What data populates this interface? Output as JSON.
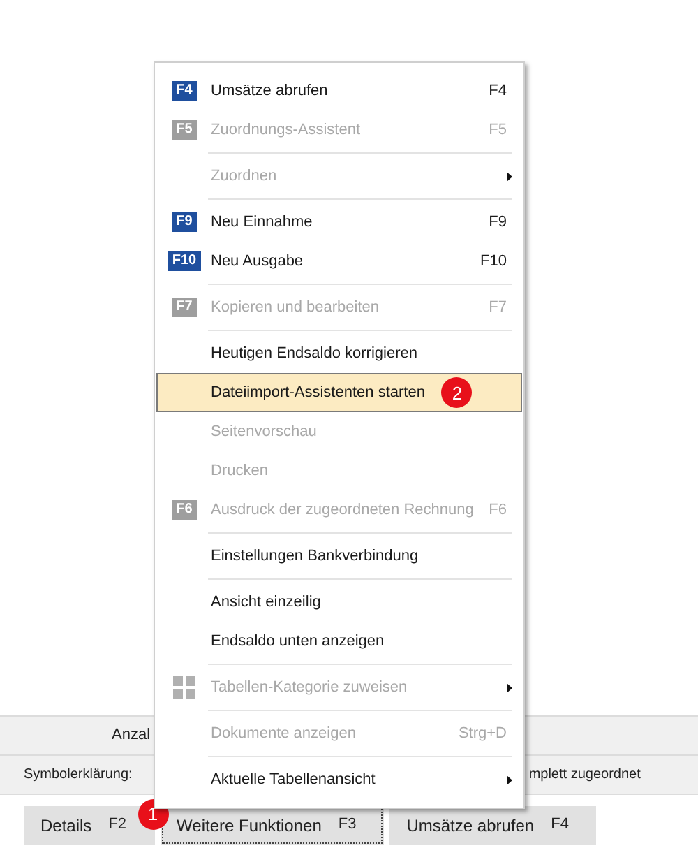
{
  "menu": {
    "items": [
      {
        "kind": "item",
        "label": "Umsätze abrufen",
        "badge": "F4",
        "shortcut": "F4",
        "disabled": false,
        "selected": false
      },
      {
        "kind": "item",
        "label": "Zuordnungs-Assistent",
        "badge": "F5",
        "shortcut": "F5",
        "disabled": true,
        "selected": false
      },
      {
        "kind": "separator"
      },
      {
        "kind": "item",
        "label": "Zuordnen",
        "disabled": true,
        "selected": false,
        "submenu": true
      },
      {
        "kind": "separator"
      },
      {
        "kind": "item",
        "label": "Neu Einnahme",
        "badge": "F9",
        "shortcut": "F9",
        "disabled": false,
        "selected": false
      },
      {
        "kind": "item",
        "label": "Neu Ausgabe",
        "badge": "F10",
        "shortcut": "F10",
        "disabled": false,
        "selected": false
      },
      {
        "kind": "separator"
      },
      {
        "kind": "item",
        "label": "Kopieren und bearbeiten",
        "badge": "F7",
        "shortcut": "F7",
        "disabled": true,
        "selected": false
      },
      {
        "kind": "separator"
      },
      {
        "kind": "item",
        "label": "Heutigen Endsaldo korrigieren",
        "disabled": false,
        "selected": false
      },
      {
        "kind": "item",
        "label": "Dateiimport-Assistenten starten",
        "disabled": false,
        "selected": true,
        "marker": "2"
      },
      {
        "kind": "item",
        "label": "Seitenvorschau",
        "disabled": true,
        "selected": false
      },
      {
        "kind": "item",
        "label": "Drucken",
        "disabled": true,
        "selected": false
      },
      {
        "kind": "item",
        "label": "Ausdruck der zugeordneten Rechnung",
        "badge": "F6",
        "shortcut": "F6",
        "disabled": true,
        "selected": false
      },
      {
        "kind": "separator"
      },
      {
        "kind": "item",
        "label": "Einstellungen Bankverbindung",
        "disabled": false,
        "selected": false
      },
      {
        "kind": "separator"
      },
      {
        "kind": "item",
        "label": "Ansicht einzeilig",
        "disabled": false,
        "selected": false
      },
      {
        "kind": "item",
        "label": "Endsaldo unten anzeigen",
        "disabled": false,
        "selected": false
      },
      {
        "kind": "separator"
      },
      {
        "kind": "item",
        "label": "Tabellen-Kategorie zuweisen",
        "disabled": true,
        "selected": false,
        "submenu": true,
        "grid_icon": true
      },
      {
        "kind": "separator"
      },
      {
        "kind": "item",
        "label": "Dokumente anzeigen",
        "shortcut": "Strg+D",
        "disabled": true,
        "selected": false
      },
      {
        "kind": "separator"
      },
      {
        "kind": "item",
        "label": "Aktuelle Tabellenansicht",
        "disabled": false,
        "selected": false,
        "submenu": true
      }
    ]
  },
  "status_row": {
    "count_label": "Anzal"
  },
  "legend_row": {
    "label": "Symbolerklärung:",
    "text": "mplett zugeordnet"
  },
  "buttons": [
    {
      "label": "Details",
      "shortcut": "F2",
      "focused": false
    },
    {
      "label": "Weitere Funktionen",
      "shortcut": "F3",
      "focused": true,
      "marker": "1"
    },
    {
      "label": "Umsätze abrufen",
      "shortcut": "F4",
      "focused": false
    }
  ]
}
